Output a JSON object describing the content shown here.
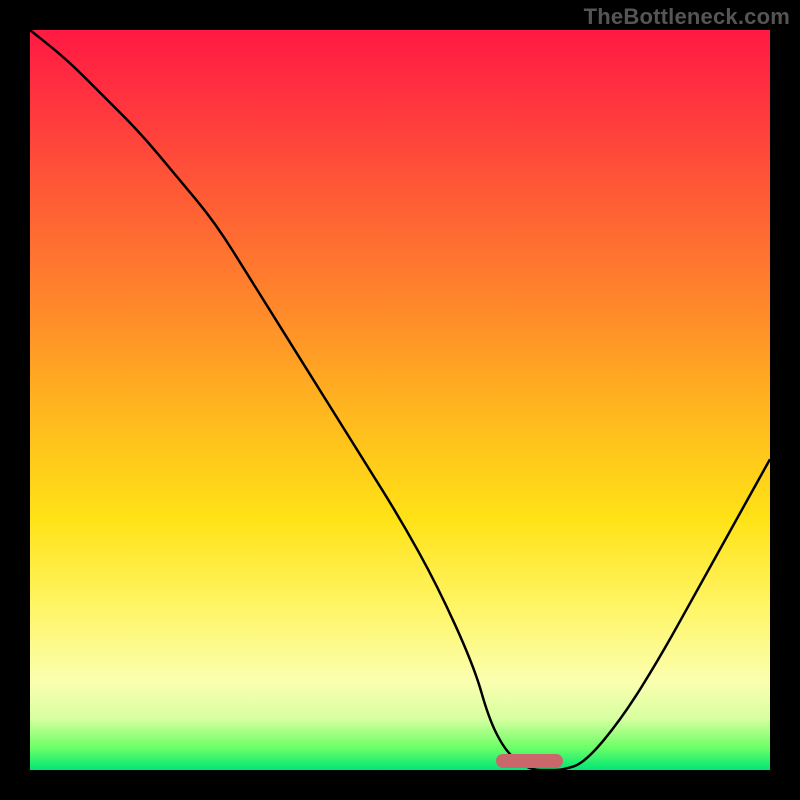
{
  "watermark": "TheBottleneck.com",
  "chart_data": {
    "type": "line",
    "title": "",
    "xlabel": "",
    "ylabel": "",
    "xlim": [
      0,
      100
    ],
    "ylim": [
      0,
      100
    ],
    "x": [
      0,
      5,
      10,
      15,
      20,
      25,
      30,
      35,
      40,
      45,
      50,
      55,
      60,
      62,
      64,
      66,
      68,
      70,
      72,
      75,
      80,
      85,
      90,
      95,
      100
    ],
    "values": [
      100,
      96,
      91,
      86,
      80,
      74,
      66,
      58,
      50,
      42,
      34,
      25,
      14,
      7,
      3,
      1,
      0,
      0,
      0,
      1,
      7,
      15,
      24,
      33,
      42
    ],
    "marker": {
      "x_start": 63,
      "x_end": 72,
      "y": 0
    }
  },
  "colors": {
    "curve": "#000000",
    "marker": "#c9676b",
    "frame": "#000000"
  }
}
